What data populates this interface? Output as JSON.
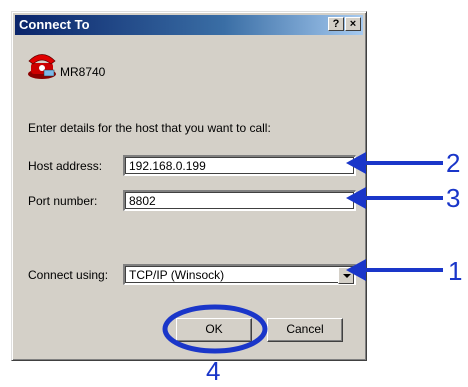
{
  "dialog": {
    "title": "Connect To",
    "help_button": "?",
    "close_button": "×",
    "connection_name": "MR8740",
    "instructions": "Enter details for the host that you want to call:",
    "host_address_label": "Host address:",
    "host_address_value": "192.168.0.199",
    "port_number_label": "Port number:",
    "port_number_value": "8802",
    "connect_using_label": "Connect using:",
    "connect_using_value": "TCP/IP (Winsock)",
    "ok_label": "OK",
    "cancel_label": "Cancel"
  },
  "callouts": {
    "host_address": "2",
    "port_number": "3",
    "connect_using": "1",
    "ok_button": "4"
  },
  "colors": {
    "callout": "#1a36c9",
    "titlebar": "#0a246a",
    "dialog_face": "#d4d0c8"
  },
  "icons": {
    "connection": "red-telephone-icon"
  }
}
